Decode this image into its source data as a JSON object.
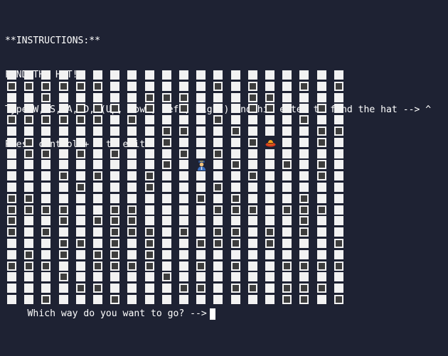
{
  "instructions": [
    "**INSTRUCTIONS:**",
    "FIND THE HAT!",
    "Type W, S, A, D, (Up, Down, Left, Right) and hit enter to find the hat --> ^",
    "Press control + c to exit."
  ],
  "prompt": "Which way do you want to go? -->",
  "legend": {
    "field": "░",
    "hole": "O",
    "hat": "^",
    "player": "*"
  },
  "icons": {
    "hat": "hat-icon",
    "player": "player-icon"
  },
  "colors": {
    "background": "#1e2233",
    "field": "#f2f2f2",
    "hole": "#3d3d3d",
    "text": "#ffffff"
  },
  "board": [
    "....................",
    "OOOOOO......O.O..O.O",
    "..O.....OOO...OO....",
    "....OOO.O.O...OO..O.",
    "OOOOOO.O....O....O..",
    ".........OO..O....OO",
    ".O.......O....O^..O.",
    ".OO.O.O...O.O.......",
    ".........O.*.O..O.O.",
    "...O.O..O.....O...O.",
    "....O...O...O.......",
    "OO.........O.O...O..",
    "OOOO..OO....OOO.OOO.",
    "O..O.OOO.........O..",
    "O.O...OOO.O.OO.O.O..",
    "...OO.O.O..OOO.O...O",
    ".O.O.OO.O...........",
    "OOO..OOOO..O.O..OOOO",
    "...O.....O..........",
    "....OO....OO.OO.OOO.",
    "..O...O.........OO.O"
  ]
}
